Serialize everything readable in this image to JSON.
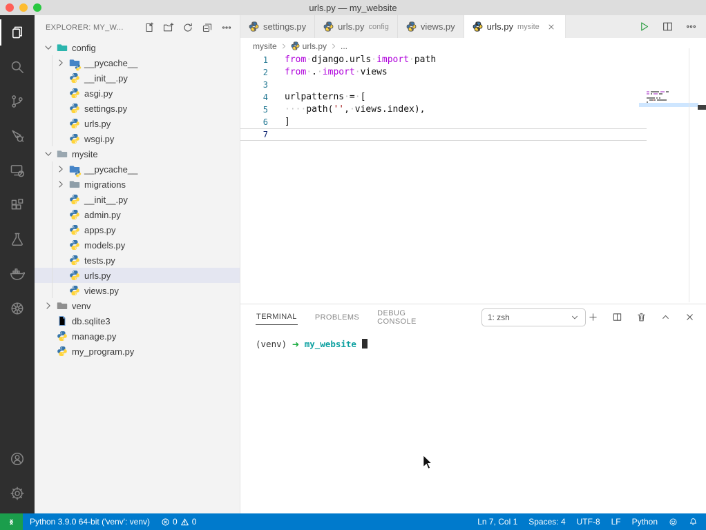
{
  "window": {
    "title": "urls.py — my_website"
  },
  "activity_bar": {
    "items": [
      {
        "name": "explorer",
        "icon": "files-icon",
        "active": true
      },
      {
        "name": "search",
        "icon": "search-icon"
      },
      {
        "name": "source-control",
        "icon": "source-control-icon"
      },
      {
        "name": "run-debug",
        "icon": "debug-icon"
      },
      {
        "name": "remote-explorer",
        "icon": "remote-icon"
      },
      {
        "name": "extensions",
        "icon": "extensions-icon"
      },
      {
        "name": "testing",
        "icon": "beaker-icon"
      },
      {
        "name": "docker",
        "icon": "docker-icon"
      },
      {
        "name": "kubernetes",
        "icon": "kubernetes-icon"
      }
    ],
    "bottom_items": [
      {
        "name": "accounts",
        "icon": "account-icon"
      },
      {
        "name": "settings",
        "icon": "gear-icon"
      }
    ]
  },
  "sidebar": {
    "title": "EXPLORER: MY_W...",
    "actions": [
      {
        "name": "new-file",
        "icon": "new-file-icon"
      },
      {
        "name": "new-folder",
        "icon": "new-folder-icon"
      },
      {
        "name": "refresh-explorer",
        "icon": "refresh-icon"
      },
      {
        "name": "collapse-folders",
        "icon": "collapse-all-icon"
      },
      {
        "name": "more-actions",
        "icon": "ellipsis-icon"
      }
    ],
    "tree": [
      {
        "label": "config",
        "depth": 0,
        "icon": "folder",
        "color": "#2bb5ad",
        "expanded": true
      },
      {
        "label": "__pycache__",
        "depth": 1,
        "icon": "pyfolder",
        "color": "#4584c7",
        "expanded": false
      },
      {
        "label": "__init__.py",
        "depth": 1,
        "icon": "python"
      },
      {
        "label": "asgi.py",
        "depth": 1,
        "icon": "python"
      },
      {
        "label": "settings.py",
        "depth": 1,
        "icon": "python"
      },
      {
        "label": "urls.py",
        "depth": 1,
        "icon": "python"
      },
      {
        "label": "wsgi.py",
        "depth": 1,
        "icon": "python"
      },
      {
        "label": "mysite",
        "depth": 0,
        "icon": "folder",
        "color": "#9aa7b0",
        "expanded": true
      },
      {
        "label": "__pycache__",
        "depth": 1,
        "icon": "pyfolder",
        "color": "#4584c7",
        "expanded": false
      },
      {
        "label": "migrations",
        "depth": 1,
        "icon": "folder",
        "color": "#8d9ea9",
        "expanded": false
      },
      {
        "label": "__init__.py",
        "depth": 1,
        "icon": "python"
      },
      {
        "label": "admin.py",
        "depth": 1,
        "icon": "python"
      },
      {
        "label": "apps.py",
        "depth": 1,
        "icon": "python"
      },
      {
        "label": "models.py",
        "depth": 1,
        "icon": "python"
      },
      {
        "label": "tests.py",
        "depth": 1,
        "icon": "python"
      },
      {
        "label": "urls.py",
        "depth": 1,
        "icon": "python",
        "selected": true
      },
      {
        "label": "views.py",
        "depth": 1,
        "icon": "python"
      },
      {
        "label": "venv",
        "depth": 0,
        "icon": "folder",
        "color": "#8f8f8f",
        "expanded": false
      },
      {
        "label": "db.sqlite3",
        "depth": 0,
        "icon": "file"
      },
      {
        "label": "manage.py",
        "depth": 0,
        "icon": "python"
      },
      {
        "label": "my_program.py",
        "depth": 0,
        "icon": "python"
      }
    ]
  },
  "editor_tabs": {
    "tabs": [
      {
        "label": "settings.py",
        "description": "",
        "active": false
      },
      {
        "label": "urls.py",
        "description": "config",
        "active": false
      },
      {
        "label": "views.py",
        "description": "",
        "active": false
      },
      {
        "label": "urls.py",
        "description": "mysite",
        "active": true
      }
    ],
    "actions": [
      {
        "name": "run-python-file",
        "icon": "play-icon",
        "cls": "run"
      },
      {
        "name": "split-editor",
        "icon": "split-icon",
        "cls": ""
      },
      {
        "name": "more-editor-actions",
        "icon": "ellipsis-icon",
        "cls": ""
      }
    ]
  },
  "breadcrumb": {
    "items": [
      {
        "label": "mysite"
      },
      {
        "label": "urls.py",
        "icon": "python-icon"
      },
      {
        "label": "..."
      }
    ]
  },
  "editor": {
    "current_line": 7,
    "lines": [
      {
        "num": "1",
        "tokens": [
          [
            "kw",
            "from"
          ],
          [
            "ws",
            "·"
          ],
          [
            "txt",
            "django.urls"
          ],
          [
            "ws",
            "·"
          ],
          [
            "kw",
            "import"
          ],
          [
            "ws",
            "·"
          ],
          [
            "txt",
            "path"
          ]
        ]
      },
      {
        "num": "2",
        "tokens": [
          [
            "kw",
            "from"
          ],
          [
            "ws",
            "·"
          ],
          [
            "txt",
            "."
          ],
          [
            "ws",
            "·"
          ],
          [
            "kw",
            "import"
          ],
          [
            "ws",
            "·"
          ],
          [
            "txt",
            "views"
          ]
        ]
      },
      {
        "num": "3",
        "tokens": []
      },
      {
        "num": "4",
        "tokens": [
          [
            "txt",
            "urlpatterns"
          ],
          [
            "ws",
            "·"
          ],
          [
            "txt",
            "="
          ],
          [
            "ws",
            "·"
          ],
          [
            "txt",
            "["
          ]
        ]
      },
      {
        "num": "5",
        "tokens": [
          [
            "ws",
            "····"
          ],
          [
            "txt",
            "path("
          ],
          [
            "str",
            "''"
          ],
          [
            "txt",
            ","
          ],
          [
            "ws",
            "·"
          ],
          [
            "txt",
            "views.index),"
          ]
        ]
      },
      {
        "num": "6",
        "tokens": [
          [
            "txt",
            "]"
          ]
        ]
      },
      {
        "num": "7",
        "tokens": []
      }
    ]
  },
  "panel": {
    "tabs": [
      {
        "label": "TERMINAL",
        "active": true
      },
      {
        "label": "PROBLEMS",
        "active": false
      },
      {
        "label": "DEBUG CONSOLE",
        "active": false
      }
    ],
    "shell_selector": "1: zsh",
    "actions": [
      {
        "name": "new-terminal",
        "icon": "plus-icon"
      },
      {
        "name": "split-terminal",
        "icon": "split-icon"
      },
      {
        "name": "kill-terminal",
        "icon": "trash-icon"
      },
      {
        "name": "maximize-panel",
        "icon": "chevron-up-icon"
      },
      {
        "name": "close-panel",
        "icon": "close-icon"
      }
    ],
    "terminal": {
      "venv": "(venv)",
      "arrow": "➜",
      "cwd": "my_website"
    }
  },
  "status_bar": {
    "interpreter": "Python 3.9.0 64-bit ('venv': venv)",
    "errors": "0",
    "warnings": "0",
    "cursor_position": "Ln 7, Col 1",
    "indentation": "Spaces: 4",
    "encoding": "UTF-8",
    "eol": "LF",
    "language": "Python"
  },
  "colors": {
    "status_bar": "#007acc",
    "remote_indicator": "#1b9e4c",
    "keyword": "#af00db",
    "string": "#a31515",
    "python_blue": "#3776ab",
    "python_yellow": "#ffd43b",
    "selection_row": "#e4e6f1"
  }
}
